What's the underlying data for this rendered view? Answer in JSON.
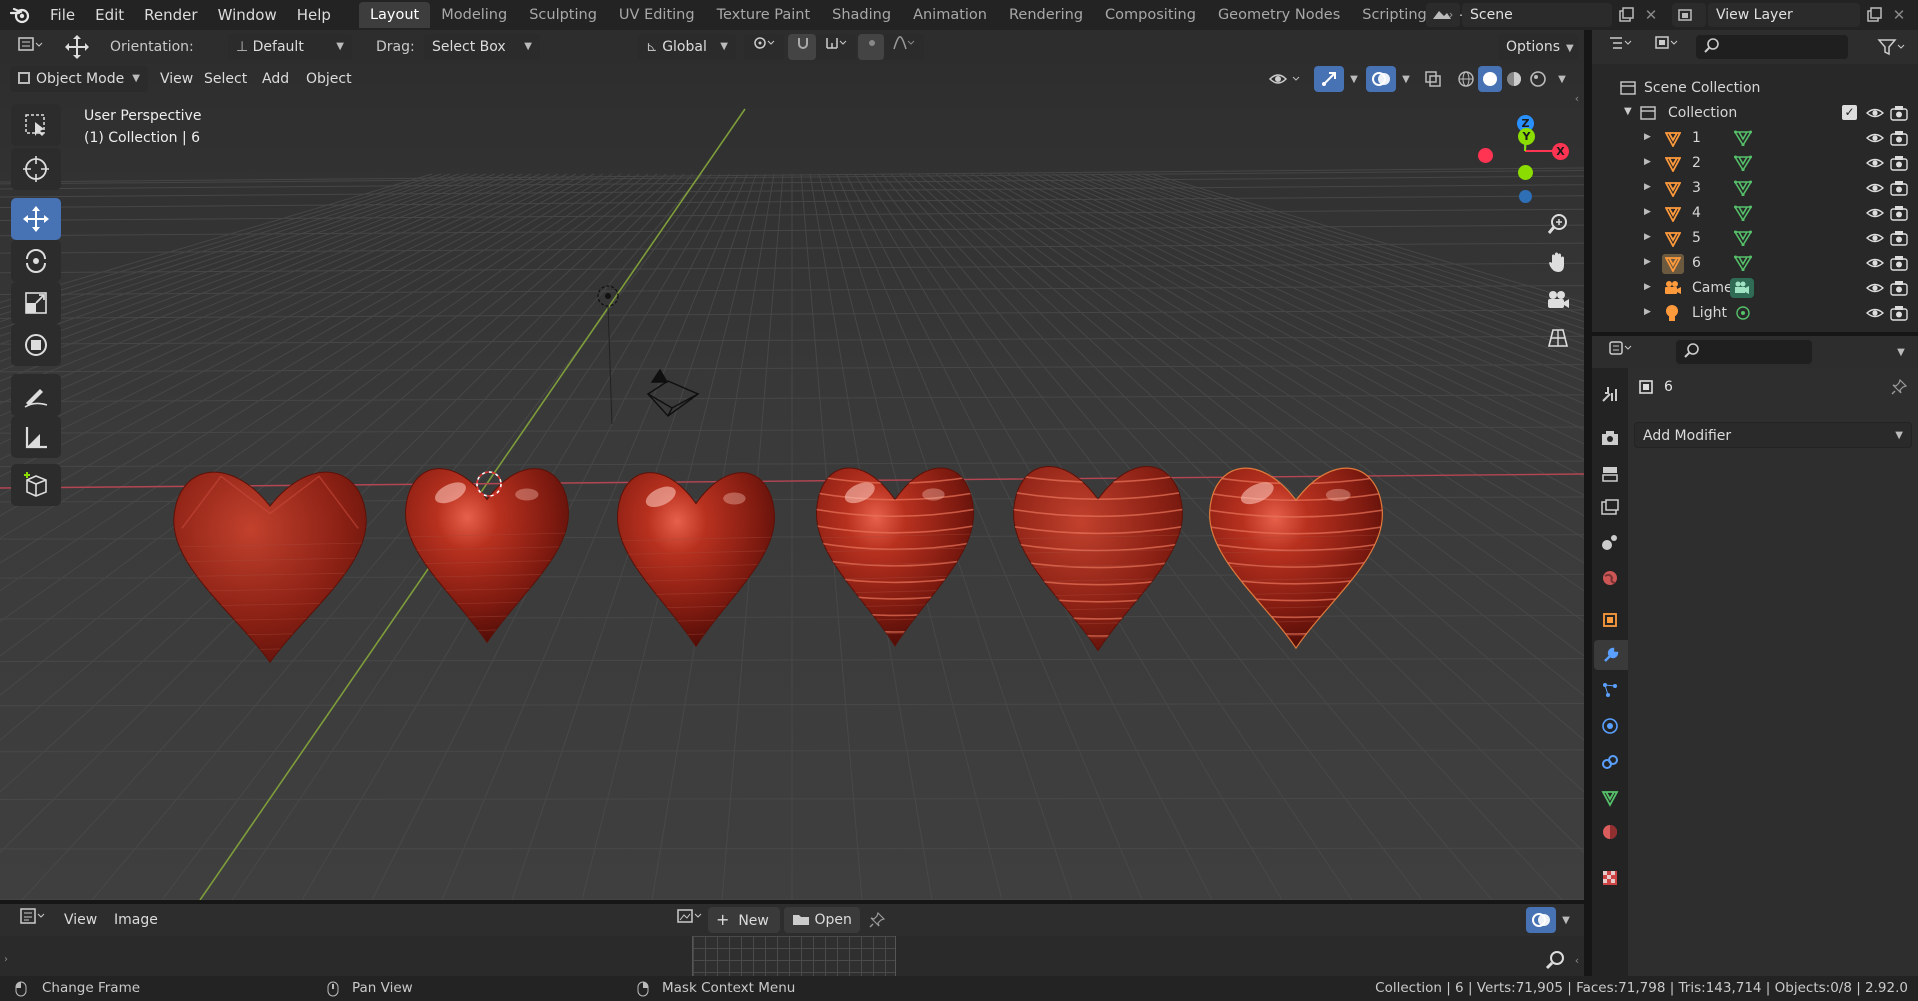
{
  "menu": [
    "File",
    "Edit",
    "Render",
    "Window",
    "Help"
  ],
  "workspaces": [
    "Layout",
    "Modeling",
    "Sculpting",
    "UV Editing",
    "Texture Paint",
    "Shading",
    "Animation",
    "Rendering",
    "Compositing",
    "Geometry Nodes",
    "Scripting"
  ],
  "active_workspace": "Layout",
  "add_workspace": "+",
  "scene": "Scene",
  "view_layer": "View Layer",
  "toolbar": {
    "orientation_label": "Orientation:",
    "orientation_value": "Default",
    "drag_label": "Drag:",
    "drag_value": "Select Box",
    "transform_orientation": "Global",
    "options": "Options"
  },
  "viewport_header": {
    "mode": "Object Mode",
    "menus": [
      "View",
      "Select",
      "Add",
      "Object"
    ]
  },
  "viewport": {
    "perspective": "User Perspective",
    "collection_info": "(1) Collection | 6",
    "axis_x": "X",
    "axis_y": "Y",
    "axis_z": "Z",
    "heart_color": "#8b1e12"
  },
  "outliner": {
    "root": "Scene Collection",
    "collection": "Collection",
    "items": [
      {
        "name": "1",
        "type": "mesh"
      },
      {
        "name": "2",
        "type": "mesh"
      },
      {
        "name": "3",
        "type": "mesh"
      },
      {
        "name": "4",
        "type": "mesh"
      },
      {
        "name": "5",
        "type": "mesh"
      },
      {
        "name": "6",
        "type": "mesh"
      },
      {
        "name": "Camera",
        "type": "camera"
      },
      {
        "name": "Light",
        "type": "light"
      }
    ]
  },
  "properties": {
    "object_name": "6",
    "add_modifier": "Add Modifier"
  },
  "timeline": {
    "menus": [
      "View",
      "Image"
    ],
    "new": "New",
    "open": "Open"
  },
  "status": {
    "left": "Change Frame",
    "middle": "Pan View",
    "right": "Mask Context Menu",
    "stats": "Collection | 6 | Verts:71,905 | Faces:71,798 | Tris:143,714 | Objects:0/8 | 2.92.0"
  },
  "colors": {
    "accent": "#4772b3",
    "x_axis": "#ff3352",
    "y_axis": "#8bdc00",
    "z_axis": "#2890ff"
  }
}
